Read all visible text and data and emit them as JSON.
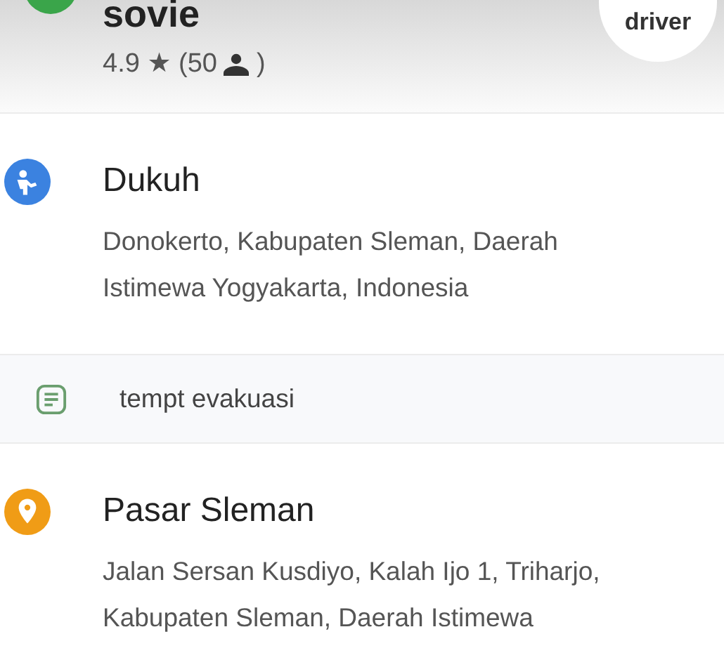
{
  "header": {
    "title": "sovie",
    "rating": "4.9 ★ (50",
    "rating_close": ")",
    "badge": "driver"
  },
  "items": [
    {
      "kind": "place",
      "color": "#3b82e0",
      "title": "Dukuh",
      "address": "Donokerto, Kabupaten Sleman, Daerah Istimewa Yogyakarta, Indonesia"
    },
    {
      "kind": "note",
      "text": "tempt evakuasi"
    },
    {
      "kind": "place",
      "color": "#f09c16",
      "title": "Pasar Sleman",
      "address": "Jalan Sersan Kusdiyo, Kalah Ijo 1, Triharjo, Kabupaten Sleman, Daerah Istimewa"
    }
  ]
}
